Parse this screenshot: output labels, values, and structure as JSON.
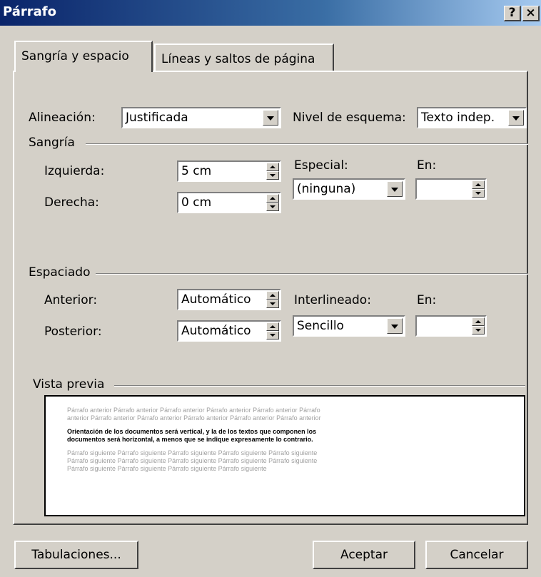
{
  "dialog": {
    "title": "Párrafo",
    "help_glyph": "?",
    "close_glyph": "×"
  },
  "tabs": [
    {
      "label": "Sangría y espacio",
      "active": true
    },
    {
      "label": "Líneas y saltos de página",
      "active": false
    }
  ],
  "general": {
    "alignment_label": "Alineación:",
    "alignment_value": "Justificada",
    "outline_label": "Nivel de esquema:",
    "outline_value": "Texto indep."
  },
  "indent": {
    "group_label": "Sangría",
    "left_label": "Izquierda:",
    "left_value": "5 cm",
    "right_label": "Derecha:",
    "right_value": "0 cm",
    "special_label": "Especial:",
    "special_value": "(ninguna)",
    "by_label": "En:",
    "by_value": ""
  },
  "spacing": {
    "group_label": "Espaciado",
    "before_label": "Anterior:",
    "before_value": "Automático",
    "after_label": "Posterior:",
    "after_value": "Automático",
    "line_label": "Interlineado:",
    "line_value": "Sencillo",
    "at_label": "En:",
    "at_value": ""
  },
  "preview": {
    "group_label": "Vista previa",
    "previous_lines": [
      "Párrafo anterior Párrafo anterior Párrafo anterior Párrafo anterior Párrafo anterior Párrafo",
      "anterior Párrafo anterior Párrafo anterior Párrafo anterior Párrafo anterior Párrafo anterior"
    ],
    "current_lines": [
      "Orientación de los documentos será vertical, y la de los textos que componen los",
      "documentos será horizontal, a menos que se indique expresamente lo contrario."
    ],
    "next_lines": [
      "Párrafo siguiente Párrafo siguiente Párrafo siguiente Párrafo siguiente Párrafo siguiente",
      "Párrafo siguiente Párrafo siguiente Párrafo siguiente Párrafo siguiente Párrafo siguiente",
      "Párrafo siguiente Párrafo siguiente Párrafo siguiente Párrafo siguiente"
    ]
  },
  "buttons": {
    "tabs_button": "Tabulaciones...",
    "ok": "Aceptar",
    "cancel": "Cancelar"
  }
}
